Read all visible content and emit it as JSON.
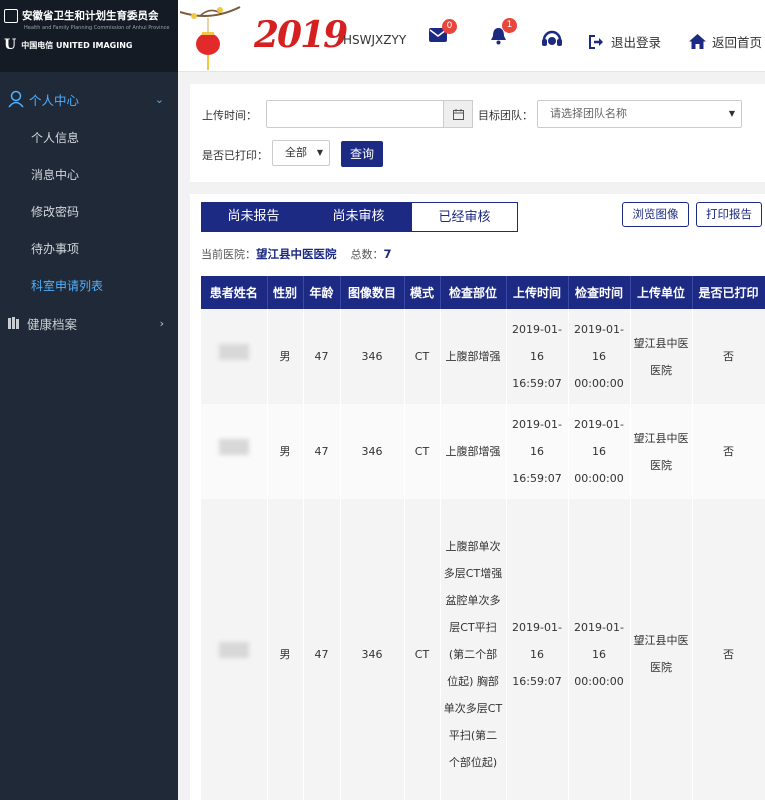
{
  "sidebar": {
    "logo_title": "安徽省卫生和计划生育委员会",
    "logo_subtitle": "Health and Family Planning Commission of Anhui Province",
    "partner_text": "中国电信 UNITED IMAGING",
    "menu": {
      "personal": "个人中心",
      "items": [
        "个人信息",
        "消息中心",
        "修改密码",
        "待办事项",
        "科室申请列表"
      ],
      "health": "健康档案"
    }
  },
  "header": {
    "year": "2019",
    "username": "HSWJXZYY",
    "mail_count": "0",
    "bell_count": "1",
    "logout": "退出登录",
    "home": "返回首页"
  },
  "filter": {
    "upload_time_label": "上传时间：",
    "upload_time_value": "",
    "team_label": "目标团队：",
    "team_placeholder": "请选择团队名称",
    "printed_label": "是否已打印：",
    "printed_value": "全部",
    "query": "查询"
  },
  "tabs": [
    "尚未报告",
    "尚未审核",
    "已经审核"
  ],
  "actions": {
    "browse": "浏览图像",
    "print": "打印报告"
  },
  "summary": {
    "hospital_label": "当前医院：",
    "hospital": "望江县中医医院",
    "total_label": "总数：",
    "total": "7"
  },
  "table": {
    "headers": [
      "患者姓名",
      "性别",
      "年龄",
      "图像数目",
      "模式",
      "检查部位",
      "上传时间",
      "检查时间",
      "上传单位",
      "是否已打印"
    ],
    "rows": [
      {
        "name": "",
        "sex": "男",
        "age": "47",
        "images": "346",
        "mode": "CT",
        "part": "上腹部增强",
        "upload": "2019-01-16 16:59:07",
        "exam": "2019-01-16 00:00:00",
        "unit": "望江县中医医院",
        "printed": "否"
      },
      {
        "name": "",
        "sex": "男",
        "age": "47",
        "images": "346",
        "mode": "CT",
        "part": "上腹部增强",
        "upload": "2019-01-16 16:59:07",
        "exam": "2019-01-16 00:00:00",
        "unit": "望江县中医医院",
        "printed": "否"
      },
      {
        "name": "",
        "sex": "男",
        "age": "47",
        "images": "346",
        "mode": "CT",
        "part": "上腹部单次多层CT增强 盆腔单次多层CT平扫(第二个部位起) 胸部单次多层CT平扫(第二个部位起)",
        "upload": "2019-01-16 16:59:07",
        "exam": "2019-01-16 00:00:00",
        "unit": "望江县中医医院",
        "printed": "否"
      }
    ]
  }
}
